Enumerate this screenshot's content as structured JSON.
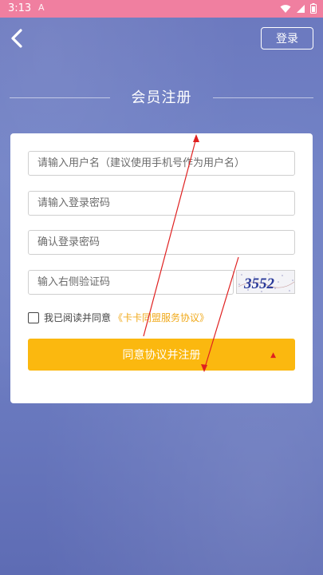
{
  "status_bar": {
    "time": "3:13",
    "notification_icon": "A"
  },
  "header": {
    "back_icon": "chevron-left-icon",
    "login_label": "登录"
  },
  "title": "会员注册",
  "form": {
    "username_placeholder": "请输入用户名（建议使用手机号作为用户名）",
    "password_placeholder": "请输入登录密码",
    "confirm_placeholder": "确认登录密码",
    "captcha_placeholder": "输入右侧验证码",
    "captcha_code": "3552",
    "agree_text": "我已阅读并同意",
    "agree_link": "《卡卡同盟服务协议》",
    "submit_label": "同意协议并注册"
  },
  "colors": {
    "status_bar": "#f07fa0",
    "accent_button": "#fbb80f",
    "link": "#f0a91a",
    "annotation_arrow": "#e02020"
  }
}
